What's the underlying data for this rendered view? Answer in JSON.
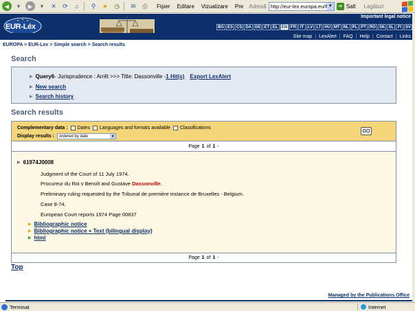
{
  "browser": {
    "menu": [
      "Fişier",
      "Editare",
      "Vizualizare",
      "Pre"
    ],
    "address_label": "Adresă",
    "address_value": "http://eur-lex.europa.eu/F",
    "go_label": "Salt",
    "links_label": "Legături",
    "status_text": "Terminat",
    "zone_text": "Internet"
  },
  "header": {
    "logo_text": "EUR-Lex",
    "legal_notice": "Important legal notice",
    "languages": [
      "BG",
      "ES",
      "CS",
      "DA",
      "DE",
      "ET",
      "EL",
      "EN",
      "FR",
      "IT",
      "LV",
      "LT",
      "HU",
      "MT",
      "NL",
      "PL",
      "PT",
      "RO",
      "SK",
      "SL",
      "FI",
      "SV"
    ],
    "active_language": "EN",
    "subnav": [
      "Site map",
      "LexAlert",
      "FAQ",
      "Help",
      "Contact",
      "Links"
    ]
  },
  "breadcrumb": "EUROPA > EUR-Lex > Simple search > Search results",
  "search": {
    "heading": "Search",
    "query_name": "Query6",
    "query_desc": " - Jurisprudence : Arrêt >>> Title: Dassonville - ",
    "hits": "1 Hit(s)",
    "export": "Export LexAlert",
    "new_search": "New search",
    "history": "Search history"
  },
  "results": {
    "heading": "Search results",
    "complementary_label": "Complementary data :",
    "options": [
      "Dates",
      "Languages and formats available",
      "Classifications"
    ],
    "display_label": "Display results :",
    "display_value": "ordered by date",
    "go_label": "GO",
    "pager": {
      "page_word": "Page",
      "current": "1",
      "of_word": "of",
      "total": "1",
      "dash": "-"
    },
    "item": {
      "id": "61974J0008",
      "line1": "Judgment of the Court of 11 July 1974.",
      "line2_pre": "Procureur du Roi v Benoît and Gustave ",
      "line2_hl": "Dassonville",
      "line2_post": ".",
      "line3": "Preliminary ruling requested by the Tribunal de première instance de Bruxelles - Belgium.",
      "line4": "Case 8-74.",
      "line5": "European Court reports 1974 Page 00837",
      "links": [
        "Bibliographic notice",
        "Bibliographic notice + Text (bilingual display)",
        "html"
      ]
    }
  },
  "top_link": "Top",
  "managed_by": "Managed by the Publications Office"
}
